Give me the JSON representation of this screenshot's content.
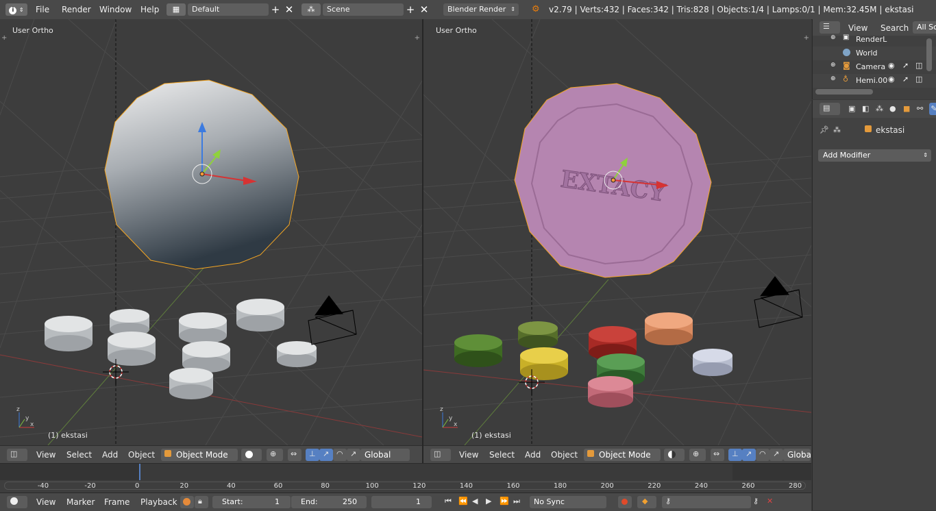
{
  "topbar": {
    "menus": [
      "File",
      "Render",
      "Window",
      "Help"
    ],
    "layout_name": "Default",
    "scene_name": "Scene",
    "render_engine": "Blender Render",
    "stats": "v2.79 | Verts:432 | Faces:342 | Tris:828 | Objects:1/4 | Lamps:0/1 | Mem:32.45M | ekstasi"
  },
  "viewport_left": {
    "label": "User Ortho",
    "object_label": "(1) ekstasi",
    "header": {
      "menus": [
        "View",
        "Select",
        "Add",
        "Object"
      ],
      "mode": "Object Mode",
      "orientation": "Global"
    }
  },
  "viewport_right": {
    "label": "User Ortho",
    "object_label": "(1) ekstasi",
    "pill_text": "EXTACY",
    "header": {
      "menus": [
        "View",
        "Select",
        "Add",
        "Object"
      ],
      "mode": "Object Mode",
      "orientation": "Global"
    }
  },
  "timeline": {
    "ruler_labels": [
      "-40",
      "-20",
      "0",
      "20",
      "40",
      "60",
      "80",
      "100",
      "120",
      "140",
      "160",
      "180",
      "200",
      "220",
      "240",
      "260",
      "280"
    ],
    "menus": [
      "View",
      "Marker",
      "Frame",
      "Playback"
    ],
    "start_label": "Start:",
    "start_value": "1",
    "end_label": "End:",
    "end_value": "250",
    "current_frame": "1",
    "sync": "No Sync"
  },
  "outliner": {
    "menus": [
      "View",
      "Search"
    ],
    "filter": "All Sc",
    "items": [
      "RenderL",
      "World",
      "Camera",
      "Hemi.00"
    ]
  },
  "properties": {
    "object_name": "ekstasi",
    "add_modifier": "Add Modifier"
  },
  "colors": {
    "accent_blue": "#5680c2",
    "selection_orange": "#f5a623",
    "grid_line": "#4a4a4a",
    "x_axis": "#c8464a",
    "y_axis": "#7fb04f"
  }
}
